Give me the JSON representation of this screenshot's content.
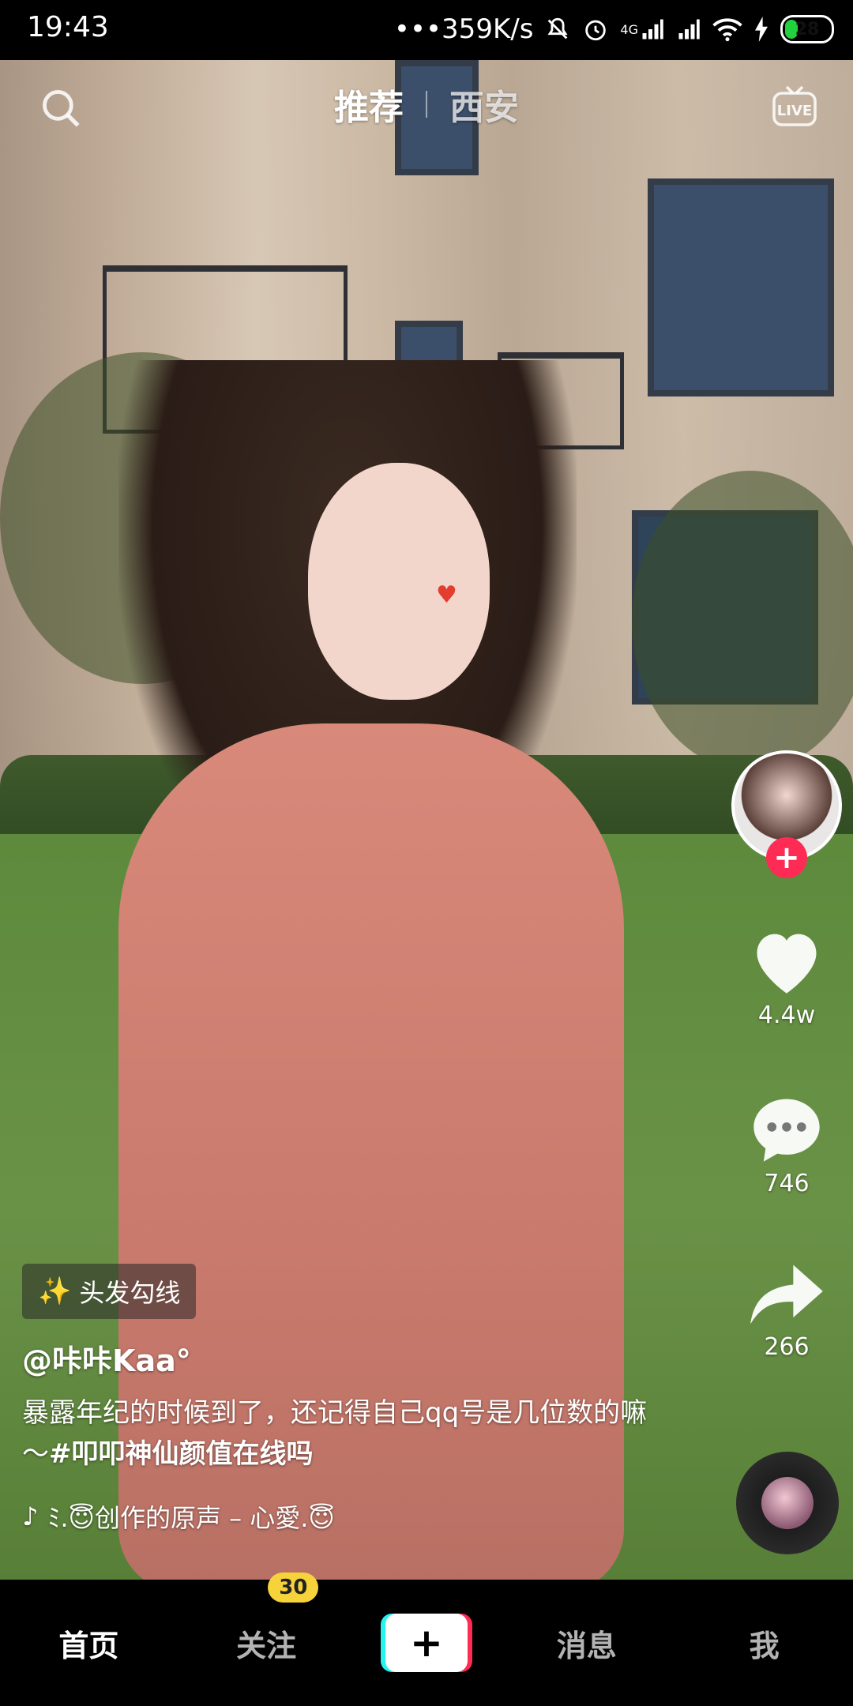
{
  "status_bar": {
    "time": "19:43",
    "network_speed": "•••359K/s",
    "signal_label": "4G",
    "battery": "28",
    "icons": [
      "mute-bell-icon",
      "alarm-icon",
      "cellular-4g-icon",
      "cellular-icon",
      "wifi-icon",
      "charging-icon",
      "battery-icon"
    ]
  },
  "top_tabs": {
    "tabs": [
      {
        "label": "推荐",
        "active": true
      },
      {
        "label": "西安",
        "active": false
      }
    ],
    "search_icon": "search-icon",
    "live_label": "LIVE"
  },
  "rail": {
    "likes": "4.4w",
    "comments": "746",
    "shares": "266",
    "follow_symbol": "+"
  },
  "video_info": {
    "effect": "头发勾线",
    "author": "@咔咔Kaa°",
    "description": "暴露年纪的时候到了，还记得自己qq号是几位数的嘛～",
    "hashtag": "#叩叩神仙颜值在线吗",
    "music": "ﾐ.😇创作的原声 – 心愛.😇"
  },
  "bottom_nav": {
    "items": [
      {
        "label": "首页",
        "active": true
      },
      {
        "label": "关注",
        "badge": "30"
      },
      {
        "label": "消息"
      },
      {
        "label": "我"
      }
    ],
    "create_symbol": "+"
  },
  "colors": {
    "accent_red": "#fe2c55",
    "accent_cyan": "#25f4ee",
    "badge_yellow": "#f7d33b"
  }
}
